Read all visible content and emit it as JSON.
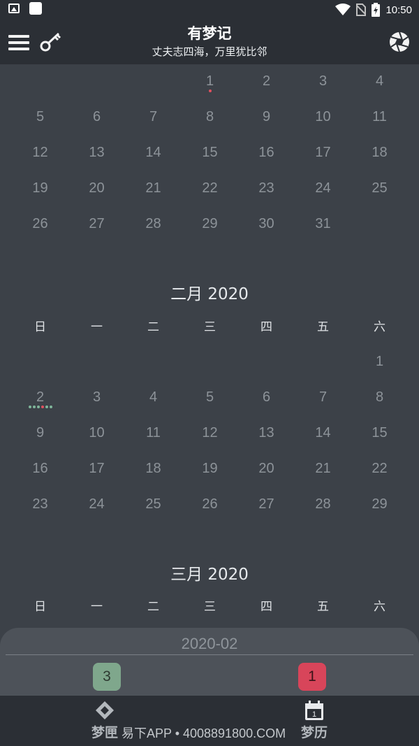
{
  "status_bar": {
    "time": "10:50"
  },
  "header": {
    "title": "有梦记",
    "subtitle": "丈夫志四海，万里犹比邻",
    "icons": [
      "menu-icon",
      "key-icon",
      "aperture-icon"
    ]
  },
  "weekdays": [
    "日",
    "一",
    "二",
    "三",
    "四",
    "五",
    "六"
  ],
  "calendar": {
    "partial_month": {
      "weeks": [
        [
          "",
          "",
          "",
          "",
          "1",
          "2",
          "3",
          "4"
        ],
        [
          "",
          "5",
          "6",
          "7",
          "8",
          "9",
          "10",
          "11"
        ]
      ],
      "rows": [
        [
          "",
          "",
          "",
          "1",
          "2",
          "3",
          "4"
        ],
        [
          "5",
          "6",
          "7",
          "8",
          "9",
          "10",
          "11"
        ],
        [
          "12",
          "13",
          "14",
          "15",
          "16",
          "17",
          "18"
        ],
        [
          "19",
          "20",
          "21",
          "22",
          "23",
          "24",
          "25"
        ],
        [
          "26",
          "27",
          "28",
          "29",
          "30",
          "31",
          ""
        ]
      ],
      "dot_day": "1",
      "dot_colors": [
        "#e0505f"
      ]
    },
    "february": {
      "title": "二月 2020",
      "rows": [
        [
          "",
          "",
          "",
          "",
          "",
          "",
          "1"
        ],
        [
          "2",
          "3",
          "4",
          "5",
          "6",
          "7",
          "8"
        ],
        [
          "9",
          "10",
          "11",
          "12",
          "13",
          "14",
          "15"
        ],
        [
          "16",
          "17",
          "18",
          "19",
          "20",
          "21",
          "22"
        ],
        [
          "23",
          "24",
          "25",
          "26",
          "27",
          "28",
          "29"
        ]
      ],
      "dot_day": "2",
      "dot_colors": [
        "#7fb59a",
        "#7fb59a",
        "#7fb59a",
        "#e0505f",
        "#7fb59a",
        "#7fb59a"
      ]
    },
    "march": {
      "title": "三月 2020"
    }
  },
  "panel": {
    "month": "2020-02",
    "green_count": "3",
    "red_count": "1",
    "colors": {
      "green": "#7fa78c",
      "red": "#d8455a"
    }
  },
  "bottom_nav": {
    "left_label": "梦匣",
    "right_label": "梦历",
    "calendar_icon_day": "1"
  },
  "watermark": "易下APP • 4008891800.COM"
}
